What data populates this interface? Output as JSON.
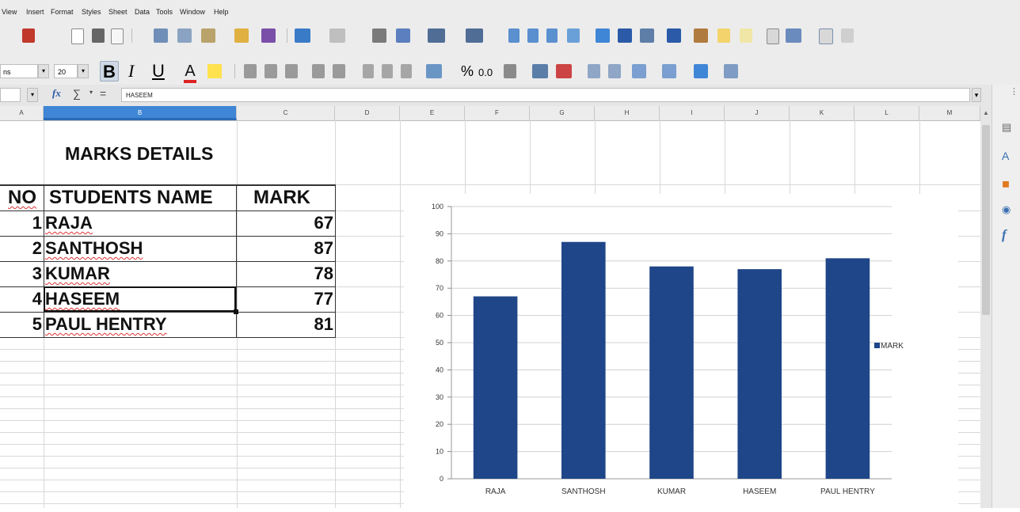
{
  "menubar": {
    "items": [
      "View",
      "Insert",
      "Format",
      "Styles",
      "Sheet",
      "Data",
      "Tools",
      "Window",
      "Help"
    ]
  },
  "format_toolbar": {
    "font_name": "ns",
    "font_size": "20",
    "bold": "B",
    "italic": "I",
    "underline": "U",
    "percent": "%",
    "decimal": "0.0"
  },
  "formula_bar": {
    "fx": "fx",
    "sum": "∑",
    "equals": "=",
    "content": "HASEEM"
  },
  "columns": [
    "A",
    "B",
    "C",
    "D",
    "E",
    "F",
    "G",
    "H",
    "I",
    "J",
    "K",
    "L",
    "M"
  ],
  "sheet": {
    "title": "MARKS DETAILS",
    "headers": {
      "no": "NO",
      "name": "STUDENTS NAME",
      "mark": "MARK"
    },
    "rows": [
      {
        "no": "1",
        "name": "RAJA",
        "mark": "67"
      },
      {
        "no": "2",
        "name": "SANTHOSH",
        "mark": "87"
      },
      {
        "no": "3",
        "name": "KUMAR",
        "mark": "78"
      },
      {
        "no": "4",
        "name": "HASEEM",
        "mark": "77"
      },
      {
        "no": "5",
        "name": "PAUL HENTRY",
        "mark": "81"
      }
    ]
  },
  "colors": {
    "bar": "#1f4688",
    "grid": "#d0d0d0",
    "accent": "#3f86d6"
  },
  "chart_data": {
    "type": "bar",
    "categories": [
      "RAJA",
      "SANTHOSH",
      "KUMAR",
      "HASEEM",
      "PAUL HENTRY"
    ],
    "series": [
      {
        "name": "MARK",
        "values": [
          67,
          87,
          78,
          77,
          81
        ]
      }
    ],
    "ylim": [
      0,
      100
    ],
    "yticks": [
      0,
      10,
      20,
      30,
      40,
      50,
      60,
      70,
      80,
      90,
      100
    ],
    "grid": true,
    "legend": "right",
    "title": "",
    "xlabel": "",
    "ylabel": ""
  }
}
